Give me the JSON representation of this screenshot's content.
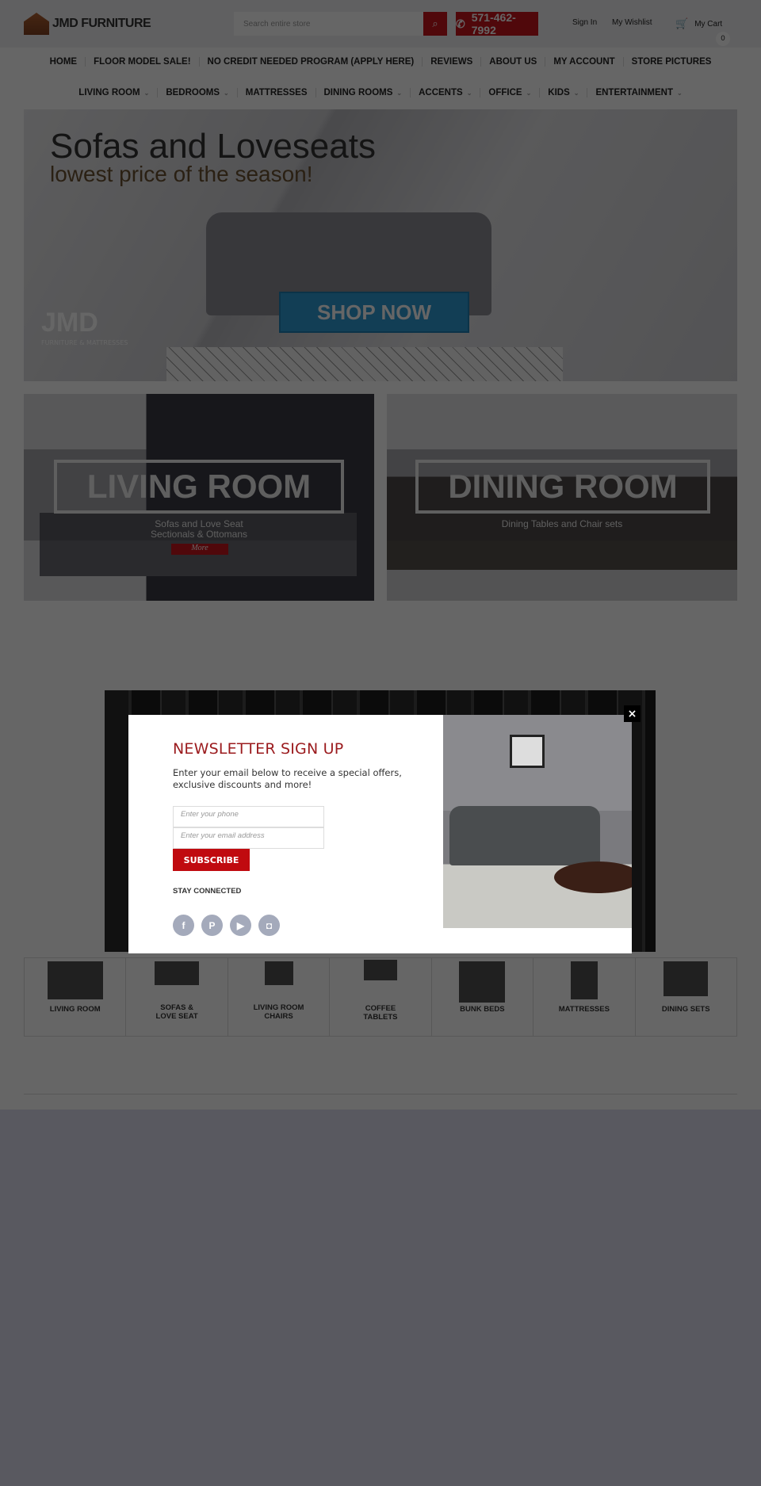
{
  "header": {
    "logo_text": "JMD FURNITURE",
    "search_placeholder": "Search entire store",
    "phone": "571-462-7992",
    "sign_in": "Sign In",
    "wishlist": "My Wishlist",
    "cart_label": "My Cart",
    "cart_count": "0"
  },
  "nav_primary": [
    "HOME",
    "FLOOR MODEL SALE!",
    "NO CREDIT NEEDED PROGRAM (APPLY HERE)",
    "REVIEWS",
    "ABOUT US",
    "MY ACCOUNT",
    "STORE PICTURES"
  ],
  "nav_categories": [
    {
      "label": "LIVING ROOM",
      "dropdown": true
    },
    {
      "label": "BEDROOMS",
      "dropdown": true
    },
    {
      "label": "MATTRESSES",
      "dropdown": false
    },
    {
      "label": "DINING ROOMS",
      "dropdown": true
    },
    {
      "label": "ACCENTS",
      "dropdown": true
    },
    {
      "label": "OFFICE",
      "dropdown": true
    },
    {
      "label": "KIDS",
      "dropdown": true
    },
    {
      "label": "ENTERTAINMENT",
      "dropdown": true
    }
  ],
  "hero": {
    "title": "Sofas and Loveseats",
    "subtitle": "lowest price of the season!",
    "cta": "SHOP NOW",
    "brand": "JMD",
    "brand_sub": "FURNITURE & MATTRESSES"
  },
  "banners": [
    {
      "title": "LIVING ROOM",
      "line1": "Sofas and Love Seat",
      "line2": "Sectionals & Ottomans",
      "button": "More"
    },
    {
      "title": "DINING ROOM",
      "line1": "Dining Tables and Chair sets"
    }
  ],
  "categories": [
    "LIVING ROOM",
    "SOFAS & LOVE SEAT",
    "LIVING ROOM CHAIRS",
    "COFFEE TABLETS",
    "BUNK BEDS",
    "MATTRESSES",
    "DINING SETS"
  ],
  "newsletter": {
    "title": "NEWSLETTER SIGN UP",
    "description": "Enter your email below to receive a special offers, exclusive discounts and more!",
    "phone_placeholder": "Enter your phone",
    "email_placeholder": "Enter your email address",
    "subscribe": "SUBSCRIBE",
    "stay_connected": "STAY CONNECTED",
    "close": "×",
    "social": [
      {
        "icon": "facebook-icon",
        "glyph": "f"
      },
      {
        "icon": "pinterest-icon",
        "glyph": "P"
      },
      {
        "icon": "youtube-icon",
        "glyph": "▶"
      },
      {
        "icon": "instagram-icon",
        "glyph": "◘"
      }
    ]
  },
  "colors": {
    "accent": "#c8151b",
    "title_red": "#9b1b1e",
    "social_gray": "#a4aabb",
    "shop_blue": "#2d9ad5"
  }
}
